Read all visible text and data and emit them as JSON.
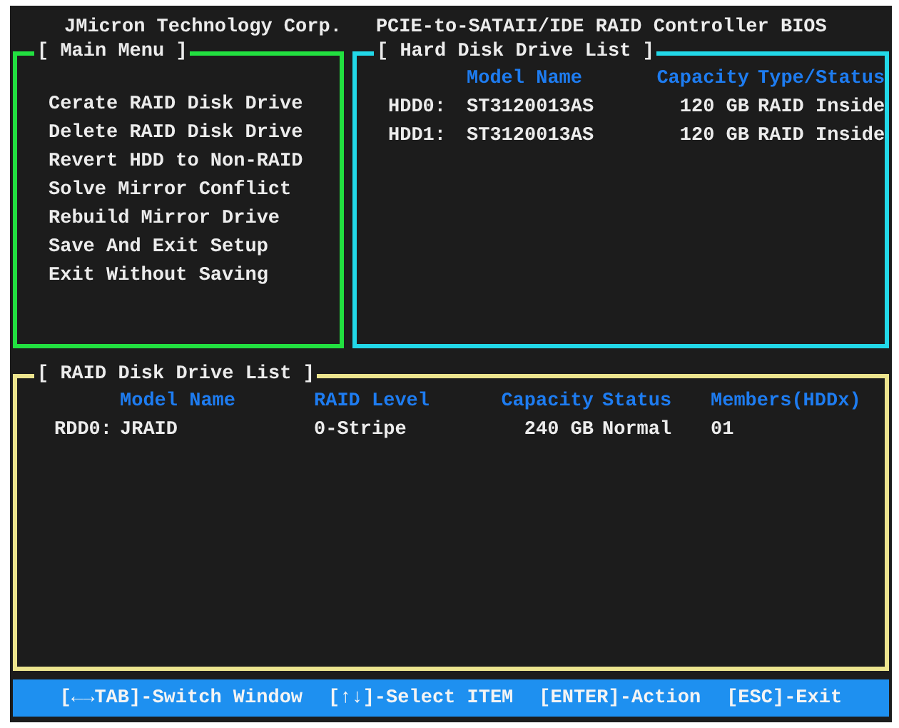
{
  "header": {
    "vendor": "JMicron Technology Corp.",
    "product": "PCIE-to-SATAII/IDE RAID Controller BIOS"
  },
  "main_menu": {
    "title": "[ Main Menu ]",
    "items": [
      "Cerate RAID Disk Drive",
      "Delete RAID Disk Drive",
      "Revert HDD to Non-RAID",
      "Solve Mirror Conflict",
      "Rebuild Mirror Drive",
      "Save And Exit Setup",
      "Exit Without Saving"
    ]
  },
  "hard_disk_list": {
    "title": "[ Hard Disk Drive List ]",
    "columns": [
      "Model Name",
      "Capacity",
      "Type/Status"
    ],
    "rows": [
      {
        "id": "HDD0:",
        "model": "ST3120013AS",
        "capacity": "120 GB",
        "type_status": "RAID Inside"
      },
      {
        "id": "HDD1:",
        "model": "ST3120013AS",
        "capacity": "120 GB",
        "type_status": "RAID Inside"
      }
    ]
  },
  "raid_list": {
    "title": "[ RAID Disk Drive List ]",
    "columns": [
      "Model Name",
      "RAID Level",
      "Capacity",
      "Status",
      "Members(HDDx)"
    ],
    "rows": [
      {
        "id": "RDD0:",
        "model": "JRAID",
        "level": "0-Stripe",
        "capacity": "240 GB",
        "status": "Normal",
        "members": "01"
      }
    ]
  },
  "status_bar": [
    "[←→TAB]-Switch Window",
    "[↑↓]-Select ITEM",
    "[ENTER]-Action",
    "[ESC]-Exit"
  ]
}
